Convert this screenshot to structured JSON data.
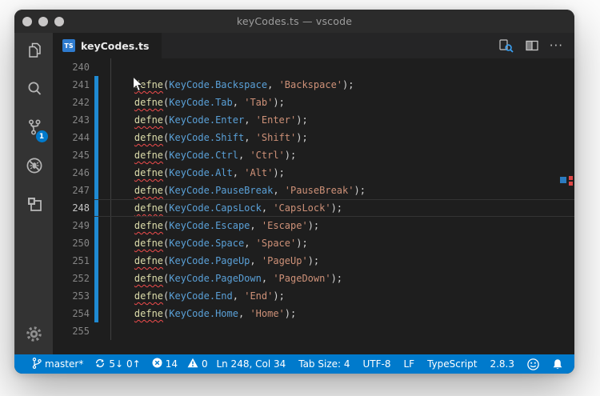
{
  "window": {
    "title": "keyCodes.ts — vscode"
  },
  "colors": {
    "statusbar_accent": "#007acc",
    "editor_background": "#1e1e1e",
    "activity_bar": "#333333",
    "git_modified_gutter": "#1f8ad2",
    "function_token": "#dcdcaa",
    "identifier_token": "#5aa0d7",
    "string_token": "#ce9178",
    "error_squiggle": "#f14c4c"
  },
  "activity_bar": {
    "items": [
      {
        "name": "explorer",
        "icon": "files-icon"
      },
      {
        "name": "search",
        "icon": "search-icon"
      },
      {
        "name": "source-control",
        "icon": "git-branch-icon",
        "badge": "1"
      },
      {
        "name": "debug",
        "icon": "debug-crossed-bug-icon"
      },
      {
        "name": "extensions",
        "icon": "extensions-icon"
      }
    ],
    "scm_badge": "1",
    "bottom": {
      "name": "settings",
      "icon": "gear-icon"
    }
  },
  "tab_bar": {
    "tab": {
      "label": "keyCodes.ts",
      "file_icon": "TS"
    },
    "actions": [
      {
        "name": "open-changes",
        "icon": "open-changes-icon"
      },
      {
        "name": "split-editor",
        "icon": "split-editor-icon"
      },
      {
        "name": "more-actions",
        "label": "···"
      }
    ]
  },
  "editor": {
    "lines": [
      {
        "num": "240",
        "modified": false,
        "current": false,
        "tokens": []
      },
      {
        "num": "241",
        "modified": true,
        "current": false,
        "tokens": [
          [
            "    ",
            "ws"
          ],
          [
            "defne",
            "fn"
          ],
          [
            "(",
            "p"
          ],
          [
            "KeyCode.Backspace",
            "id"
          ],
          [
            ",",
            "p"
          ],
          [
            " ",
            "ws"
          ],
          [
            "'Backspace'",
            "str"
          ],
          [
            ");",
            "p"
          ]
        ]
      },
      {
        "num": "242",
        "modified": true,
        "current": false,
        "tokens": [
          [
            "    ",
            "ws"
          ],
          [
            "defne",
            "fn"
          ],
          [
            "(",
            "p"
          ],
          [
            "KeyCode.Tab",
            "id"
          ],
          [
            ",",
            "p"
          ],
          [
            " ",
            "ws"
          ],
          [
            "'Tab'",
            "str"
          ],
          [
            ");",
            "p"
          ]
        ]
      },
      {
        "num": "243",
        "modified": true,
        "current": false,
        "tokens": [
          [
            "    ",
            "ws"
          ],
          [
            "defne",
            "fn"
          ],
          [
            "(",
            "p"
          ],
          [
            "KeyCode.Enter",
            "id"
          ],
          [
            ",",
            "p"
          ],
          [
            " ",
            "ws"
          ],
          [
            "'Enter'",
            "str"
          ],
          [
            ");",
            "p"
          ]
        ]
      },
      {
        "num": "244",
        "modified": true,
        "current": false,
        "tokens": [
          [
            "    ",
            "ws"
          ],
          [
            "defne",
            "fn"
          ],
          [
            "(",
            "p"
          ],
          [
            "KeyCode.Shift",
            "id"
          ],
          [
            ",",
            "p"
          ],
          [
            " ",
            "ws"
          ],
          [
            "'Shift'",
            "str"
          ],
          [
            ");",
            "p"
          ]
        ]
      },
      {
        "num": "245",
        "modified": true,
        "current": false,
        "tokens": [
          [
            "    ",
            "ws"
          ],
          [
            "defne",
            "fn"
          ],
          [
            "(",
            "p"
          ],
          [
            "KeyCode.Ctrl",
            "id"
          ],
          [
            ",",
            "p"
          ],
          [
            " ",
            "ws"
          ],
          [
            "'Ctrl'",
            "str"
          ],
          [
            ");",
            "p"
          ]
        ]
      },
      {
        "num": "246",
        "modified": true,
        "current": false,
        "tokens": [
          [
            "    ",
            "ws"
          ],
          [
            "defne",
            "fn"
          ],
          [
            "(",
            "p"
          ],
          [
            "KeyCode.Alt",
            "id"
          ],
          [
            ",",
            "p"
          ],
          [
            " ",
            "ws"
          ],
          [
            "'Alt'",
            "str"
          ],
          [
            ");",
            "p"
          ]
        ]
      },
      {
        "num": "247",
        "modified": true,
        "current": false,
        "tokens": [
          [
            "    ",
            "ws"
          ],
          [
            "defne",
            "fn"
          ],
          [
            "(",
            "p"
          ],
          [
            "KeyCode.PauseBreak",
            "id"
          ],
          [
            ",",
            "p"
          ],
          [
            " ",
            "ws"
          ],
          [
            "'PauseBreak'",
            "str"
          ],
          [
            ");",
            "p"
          ]
        ]
      },
      {
        "num": "248",
        "modified": true,
        "current": true,
        "tokens": [
          [
            "    ",
            "ws"
          ],
          [
            "defne",
            "fn"
          ],
          [
            "(",
            "p"
          ],
          [
            "KeyCode.CapsLock",
            "id"
          ],
          [
            ",",
            "p"
          ],
          [
            " ",
            "ws"
          ],
          [
            "'CapsLock'",
            "str"
          ],
          [
            ");",
            "p"
          ]
        ]
      },
      {
        "num": "249",
        "modified": true,
        "current": false,
        "tokens": [
          [
            "    ",
            "ws"
          ],
          [
            "defne",
            "fn"
          ],
          [
            "(",
            "p"
          ],
          [
            "KeyCode.Escape",
            "id"
          ],
          [
            ",",
            "p"
          ],
          [
            " ",
            "ws"
          ],
          [
            "'Escape'",
            "str"
          ],
          [
            ");",
            "p"
          ]
        ]
      },
      {
        "num": "250",
        "modified": true,
        "current": false,
        "tokens": [
          [
            "    ",
            "ws"
          ],
          [
            "defne",
            "fn"
          ],
          [
            "(",
            "p"
          ],
          [
            "KeyCode.Space",
            "id"
          ],
          [
            ",",
            "p"
          ],
          [
            " ",
            "ws"
          ],
          [
            "'Space'",
            "str"
          ],
          [
            ");",
            "p"
          ]
        ]
      },
      {
        "num": "251",
        "modified": true,
        "current": false,
        "tokens": [
          [
            "    ",
            "ws"
          ],
          [
            "defne",
            "fn"
          ],
          [
            "(",
            "p"
          ],
          [
            "KeyCode.PageUp",
            "id"
          ],
          [
            ",",
            "p"
          ],
          [
            " ",
            "ws"
          ],
          [
            "'PageUp'",
            "str"
          ],
          [
            ");",
            "p"
          ]
        ]
      },
      {
        "num": "252",
        "modified": true,
        "current": false,
        "tokens": [
          [
            "    ",
            "ws"
          ],
          [
            "defne",
            "fn"
          ],
          [
            "(",
            "p"
          ],
          [
            "KeyCode.PageDown",
            "id"
          ],
          [
            ",",
            "p"
          ],
          [
            " ",
            "ws"
          ],
          [
            "'PageDown'",
            "str"
          ],
          [
            ");",
            "p"
          ]
        ]
      },
      {
        "num": "253",
        "modified": true,
        "current": false,
        "tokens": [
          [
            "    ",
            "ws"
          ],
          [
            "defne",
            "fn"
          ],
          [
            "(",
            "p"
          ],
          [
            "KeyCode.End",
            "id"
          ],
          [
            ",",
            "p"
          ],
          [
            " ",
            "ws"
          ],
          [
            "'End'",
            "str"
          ],
          [
            ");",
            "p"
          ]
        ]
      },
      {
        "num": "254",
        "modified": true,
        "current": false,
        "tokens": [
          [
            "    ",
            "ws"
          ],
          [
            "defne",
            "fn"
          ],
          [
            "(",
            "p"
          ],
          [
            "KeyCode.Home",
            "id"
          ],
          [
            ",",
            "p"
          ],
          [
            " ",
            "ws"
          ],
          [
            "'Home'",
            "str"
          ],
          [
            ");",
            "p"
          ]
        ]
      },
      {
        "num": "255",
        "modified": false,
        "current": false,
        "tokens": []
      }
    ]
  },
  "status_bar": {
    "branch": "master*",
    "sync_incoming": "5↓",
    "sync_outgoing": "0↑",
    "error_count": "14",
    "warning_count": "0",
    "cursor_position": "Ln 248, Col 34",
    "tab_size": "Tab Size: 4",
    "encoding": "UTF-8",
    "eol": "LF",
    "language": "TypeScript",
    "version": "2.8.3"
  }
}
